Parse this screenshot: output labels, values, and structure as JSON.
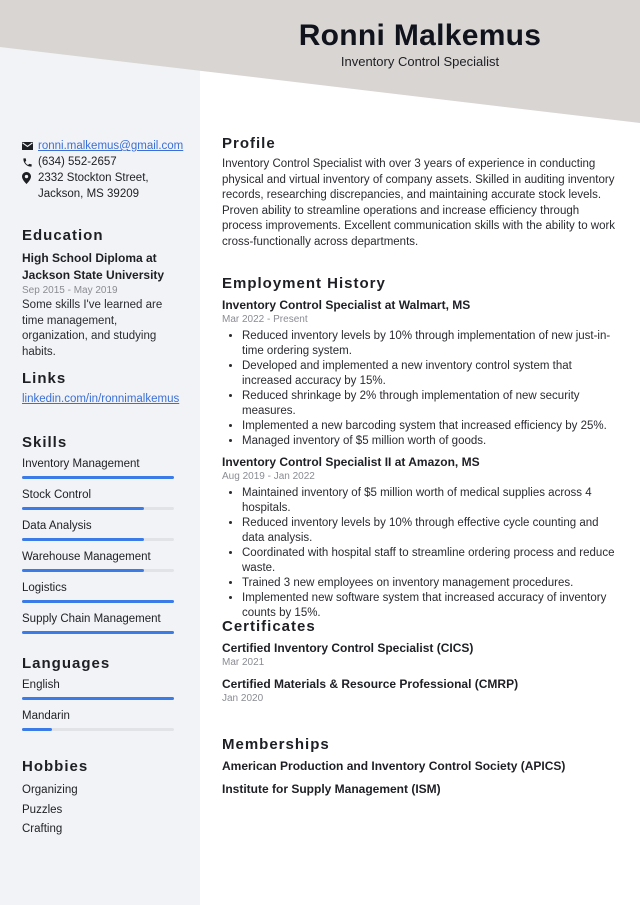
{
  "header": {
    "name": "Ronni Malkemus",
    "title": "Inventory Control Specialist",
    "bg_color": "#d8d5d3"
  },
  "contact": {
    "email": "ronni.malkemus@gmail.com",
    "phone": "(634) 552-2657",
    "address_line1": "2332 Stockton Street,",
    "address_line2": "Jackson, MS 39209"
  },
  "education": {
    "heading": "Education",
    "degree_line1": "High School Diploma at",
    "degree_line2": "Jackson State University",
    "dates": "Sep 2015 - May 2019",
    "description": "Some skills I've learned are time management, organization, and studying habits."
  },
  "links": {
    "heading": "Links",
    "items": [
      {
        "label": "linkedin.com/in/ronnimalkemus"
      }
    ]
  },
  "skills": {
    "heading": "Skills",
    "accent": "#3b7be8",
    "items": [
      {
        "label": "Inventory Management",
        "level": 1.0
      },
      {
        "label": "Stock Control",
        "level": 0.8
      },
      {
        "label": "Data Analysis",
        "level": 0.8
      },
      {
        "label": "Warehouse Management",
        "level": 0.8
      },
      {
        "label": "Logistics",
        "level": 1.0
      },
      {
        "label": "Supply Chain Management",
        "level": 1.0
      }
    ]
  },
  "languages": {
    "heading": "Languages",
    "items": [
      {
        "label": "English",
        "level": 1.0
      },
      {
        "label": "Mandarin",
        "level": 0.2
      }
    ]
  },
  "hobbies": {
    "heading": "Hobbies",
    "items": [
      "Organizing",
      "Puzzles",
      "Crafting"
    ]
  },
  "profile": {
    "heading": "Profile",
    "text": "Inventory Control Specialist with over 3 years of experience in conducting physical and virtual inventory of company assets. Skilled in auditing inventory records, researching discrepancies, and maintaining accurate stock levels. Proven ability to streamline operations and increase efficiency through process improvements. Excellent communication skills with the ability to work cross-functionally across departments."
  },
  "employment": {
    "heading": "Employment History",
    "jobs": [
      {
        "title": "Inventory Control Specialist at Walmart, MS",
        "dates": "Mar 2022 - Present",
        "bullets": [
          "Reduced inventory levels by 10% through implementation of new just-in-time ordering system.",
          "Developed and implemented a new inventory control system that increased accuracy by 15%.",
          "Reduced shrinkage by 2% through implementation of new security measures.",
          "Implemented a new barcoding system that increased efficiency by 25%.",
          "Managed inventory of $5 million worth of goods."
        ]
      },
      {
        "title": "Inventory Control Specialist II at Amazon, MS",
        "dates": "Aug 2019 - Jan 2022",
        "bullets": [
          "Maintained inventory of $5 million worth of medical supplies across 4 hospitals.",
          "Reduced inventory levels by 10% through effective cycle counting and data analysis.",
          "Coordinated with hospital staff to streamline ordering process and reduce waste.",
          "Trained 3 new employees on inventory management procedures.",
          "Implemented new software system that increased accuracy of inventory counts by 15%."
        ]
      }
    ]
  },
  "certificates": {
    "heading": "Certificates",
    "items": [
      {
        "title": "Certified Inventory Control Specialist (CICS)",
        "date": "Mar 2021"
      },
      {
        "title": "Certified Materials & Resource Professional (CMRP)",
        "date": "Jan 2020"
      }
    ]
  },
  "memberships": {
    "heading": "Memberships",
    "items": [
      "American Production and Inventory Control Society (APICS)",
      "Institute for Supply Management (ISM)"
    ]
  }
}
